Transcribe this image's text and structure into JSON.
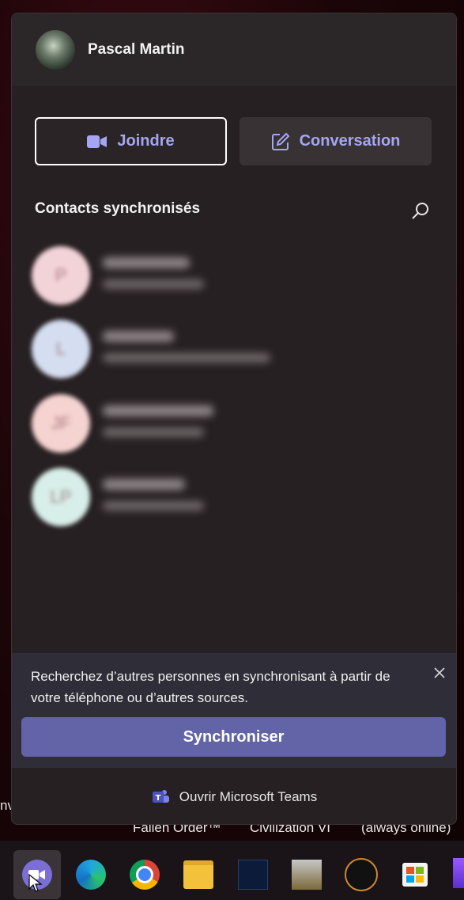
{
  "user": {
    "name": "Pascal Martin"
  },
  "actions": {
    "join_label": "Joindre",
    "chat_label": "Conversation"
  },
  "contacts": {
    "title": "Contacts synchronisés",
    "items": [
      {
        "initials": "P",
        "avatar_color": "#f2d3d8"
      },
      {
        "initials": "L",
        "avatar_color": "#d4def0"
      },
      {
        "initials": "JF",
        "avatar_color": "#f5d3d1"
      },
      {
        "initials": "LP",
        "avatar_color": "#d8eee8"
      }
    ]
  },
  "sync": {
    "message": "Recherchez d’autres personnes en synchronisant à partir de votre téléphone ou d’autres sources.",
    "button_label": "Synchroniser"
  },
  "footer": {
    "open_teams_label": "Ouvrir Microsoft Teams"
  },
  "desktop_labels": [
    "nv",
    "Fallen Order™",
    "Civilization VI",
    "(always online)"
  ],
  "taskbar": {
    "apps": [
      "teams-chat",
      "edge",
      "chrome",
      "file-explorer",
      "flight-simulator",
      "spad-next",
      "star-citizen",
      "microsoft-store"
    ]
  },
  "colors": {
    "accent": "#6264a7",
    "accent_text": "#a4a6f2",
    "flyout_bg": "#272022"
  }
}
